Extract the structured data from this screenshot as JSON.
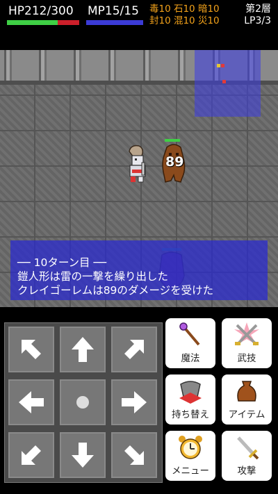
{
  "hud": {
    "hp_text": "HP212/300",
    "mp_text": "MP15/15",
    "hp_fraction": 0.7067,
    "mp_fraction": 1.0,
    "status_line1": "毒10 石10 暗10",
    "status_line2": "封10 混10 災10",
    "floor": "第2層",
    "lp": "LP3/3"
  },
  "battle": {
    "damage_popup": "89"
  },
  "log": {
    "turn": "── 10ターン目 ──",
    "line1": "鎧人形は雷の一撃を繰り出した",
    "line2": "クレイゴーレムは89のダメージを受けた"
  },
  "commands": {
    "magic": "魔法",
    "skill": "武技",
    "swap": "持ち替え",
    "item": "アイテム",
    "menu": "メニュー",
    "attack": "攻撃"
  },
  "colors": {
    "hp": "#3fcf45",
    "hp_lost": "#cc1f2a",
    "mp": "#3b3bd6",
    "status": "#f3a21a",
    "log_bg": "#2828d2"
  }
}
